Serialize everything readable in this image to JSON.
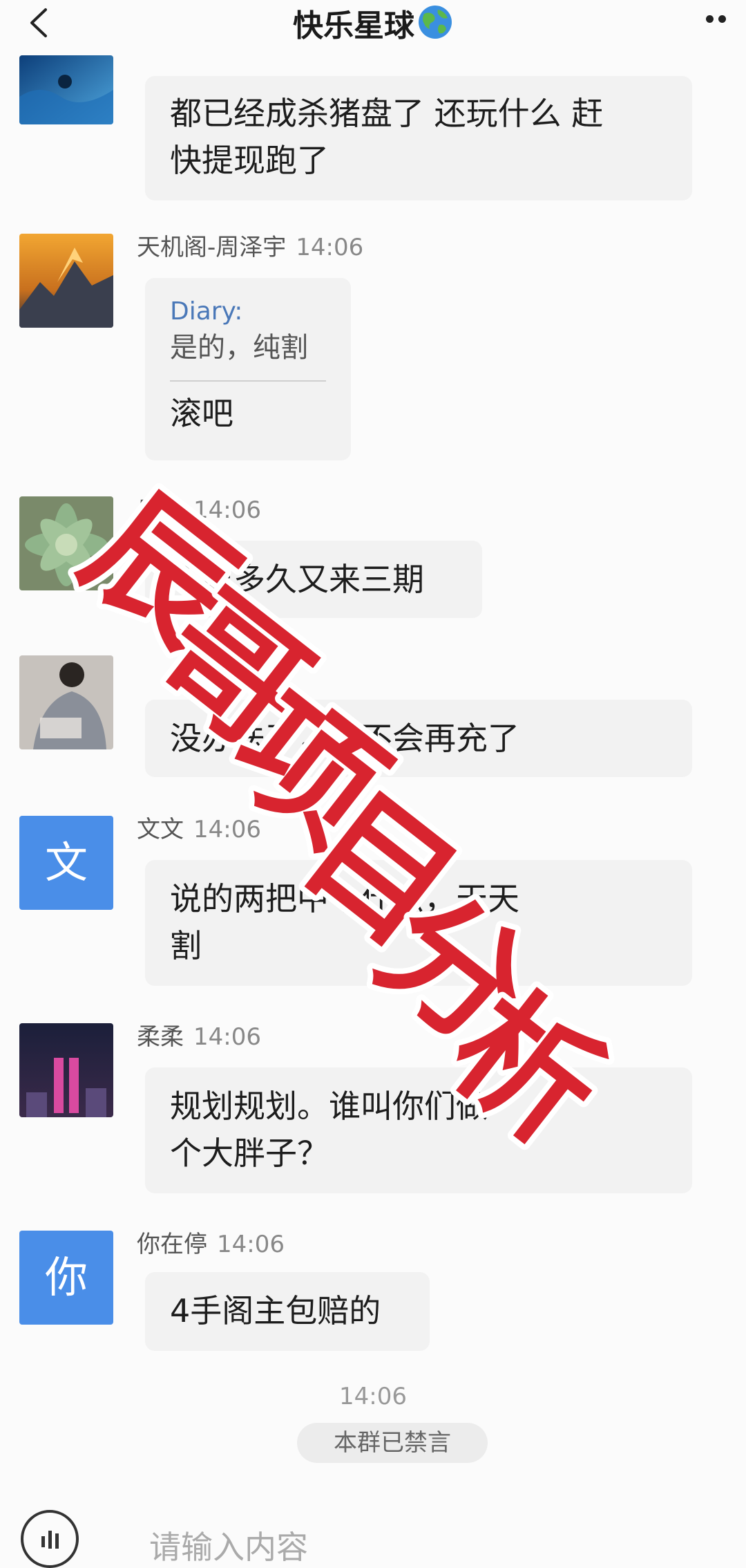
{
  "header": {
    "title": "快乐星球",
    "title_emoji": "🌏"
  },
  "messages": [
    {
      "sender": "",
      "time": "",
      "avatar": "ocean-photo",
      "text": [
        "都已经成杀猪盘了 还玩什么 赶",
        "快提现跑了"
      ]
    },
    {
      "sender": "天机阁-周泽宇",
      "time": "14:06",
      "avatar": "mountain-photo",
      "quote_name": "Diary:",
      "quote_text": "是的，纯割",
      "text": [
        "滚吧"
      ]
    },
    {
      "sender": "乐乐",
      "time": "14:06",
      "avatar": "succulent-photo",
      "text": [
        "不要多久又来三期"
      ]
    },
    {
      "sender": "",
      "time": "",
      "avatar": "person-photo",
      "text": [
        "没办法了，也不会再充了"
      ]
    },
    {
      "sender": "文文",
      "time": "14:06",
      "avatar_text": "文",
      "text": [
        "说的两把中个什么，天天",
        "割"
      ]
    },
    {
      "sender": "柔柔",
      "time": "14:06",
      "avatar": "city-night-photo",
      "text": [
        "规划规划。谁叫你们做",
        "个大胖子？"
      ]
    },
    {
      "sender": "你在停",
      "time": "14:06",
      "avatar_text": "你",
      "text": [
        "4手阁主包赔的"
      ]
    }
  ],
  "system": {
    "time": "14:06",
    "notice": "本群已禁言"
  },
  "input": {
    "placeholder": "请输入内容"
  },
  "watermark": {
    "text": "辰哥项目分析",
    "color": "#d8242f"
  }
}
